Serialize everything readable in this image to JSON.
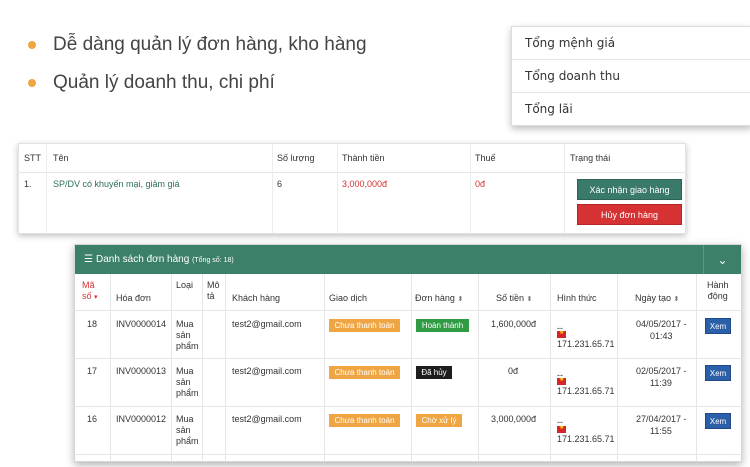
{
  "bullets": [
    {
      "text": "Dễ dàng quản lý đơn hàng, kho hàng",
      "dot_color": "#f0a543"
    },
    {
      "text": "Quản lý doanh thu, chi phí",
      "dot_color": "#f0a543"
    }
  ],
  "summary": {
    "items": [
      "Tổng mệnh giá",
      "Tổng doanh thu",
      "Tổng lãi"
    ]
  },
  "order": {
    "headers": {
      "stt": "STT",
      "name": "Tên",
      "qty": "Số lượng",
      "amount": "Thành tiền",
      "tax": "Thuế",
      "status": "Trạng thái"
    },
    "row": {
      "stt": "1.",
      "name": "SP/DV có khuyến mại, giảm giá",
      "qty": "6",
      "amount": "3,000,000đ",
      "tax": "0đ"
    },
    "confirm_label": "Xác nhận giao hàng",
    "cancel_label": "Hủy đơn hàng"
  },
  "list": {
    "title": "Danh sách đơn hàng",
    "total": "(Tổng số: 18)",
    "headers": {
      "id": [
        "Mã",
        "số"
      ],
      "invoice": "Hóa đơn",
      "type": "Loại",
      "desc": [
        "Mô",
        "tả"
      ],
      "customer": "Khách hàng",
      "transaction": "Giao dịch",
      "order": "Đơn hàng",
      "amount": "Số tiền",
      "method": "Hình thức",
      "created": "Ngày tạo",
      "action": [
        "Hành",
        "động"
      ]
    },
    "rows": [
      {
        "id": "18",
        "invoice": "INV0000014",
        "type": [
          "Mua",
          "sản",
          "phẩm"
        ],
        "customer": "test2@gmail.com",
        "transaction": "Chưa thanh toán",
        "order": "Hoàn thành",
        "amount": "1,600,000đ",
        "method_dash": "--",
        "ip": "171.231.65.71",
        "date": "04/05/2017 -",
        "time": "01:43",
        "action": "Xem"
      },
      {
        "id": "17",
        "invoice": "INV0000013",
        "type": [
          "Mua",
          "sản",
          "phẩm"
        ],
        "customer": "test2@gmail.com",
        "transaction": "Chưa thanh toán",
        "order": "Đã hủy",
        "amount": "0đ",
        "method_dash": "--",
        "ip": "171.231.65.71",
        "date": "02/05/2017 -",
        "time": "11:39",
        "action": "Xem"
      },
      {
        "id": "16",
        "invoice": "INV0000012",
        "type": [
          "Mua",
          "sản",
          "phẩm"
        ],
        "customer": "test2@gmail.com",
        "transaction": "Chưa thanh toán",
        "order": "Chờ xử lý",
        "amount": "3,000,000đ",
        "method_dash": "--",
        "ip": "171.231.65.71",
        "date": "27/04/2017 -",
        "time": "11:55",
        "action": "Xem"
      }
    ],
    "colors": {
      "header_bar": "#3c8069",
      "orange": "#f0a543",
      "green": "#2f9b43",
      "black": "#1d1d1d",
      "blue": "#2b5fa8",
      "red": "#d63234"
    }
  }
}
